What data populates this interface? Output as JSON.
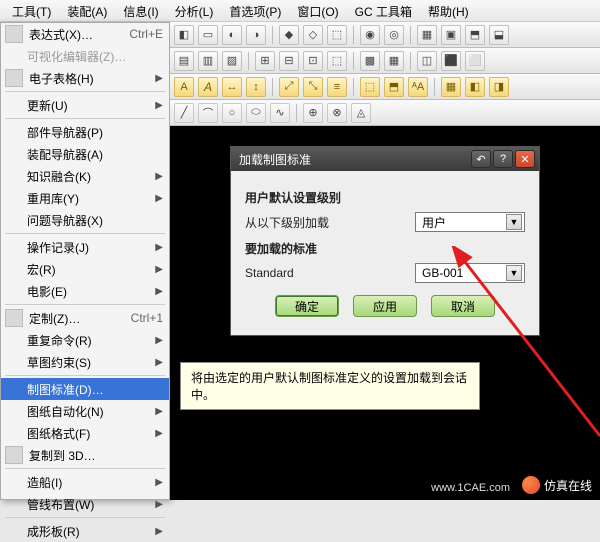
{
  "menubar": [
    "工具(T)",
    "装配(A)",
    "信息(I)",
    "分析(L)",
    "首选项(P)",
    "窗口(O)",
    "GC 工具箱",
    "帮助(H)"
  ],
  "dropdown": [
    {
      "label": "表达式(X)…",
      "shortcut": "Ctrl+E",
      "icon": true
    },
    {
      "label": "可视化编辑器(Z)…",
      "disabled": true
    },
    {
      "label": "电子表格(H)",
      "arrow": true,
      "icon": true
    },
    {
      "sep": true
    },
    {
      "label": "更新(U)",
      "arrow": true
    },
    {
      "sep": true
    },
    {
      "label": "部件导航器(P)"
    },
    {
      "label": "装配导航器(A)"
    },
    {
      "label": "知识融合(K)",
      "arrow": true
    },
    {
      "label": "重用库(Y)",
      "arrow": true
    },
    {
      "label": "问题导航器(X)"
    },
    {
      "sep": true
    },
    {
      "label": "操作记录(J)",
      "arrow": true
    },
    {
      "label": "宏(R)",
      "arrow": true
    },
    {
      "label": "电影(E)",
      "arrow": true
    },
    {
      "sep": true
    },
    {
      "label": "定制(Z)…",
      "shortcut": "Ctrl+1",
      "icon": true
    },
    {
      "label": "重复命令(R)",
      "arrow": true
    },
    {
      "label": "草图约束(S)",
      "arrow": true
    },
    {
      "sep": true
    },
    {
      "label": "制图标准(D)…",
      "selected": true
    },
    {
      "label": "图纸自动化(N)",
      "arrow": true
    },
    {
      "label": "图纸格式(F)",
      "arrow": true
    },
    {
      "label": "复制到 3D…",
      "icon": true
    },
    {
      "sep": true
    },
    {
      "label": "造船(I)",
      "arrow": true
    },
    {
      "label": "管线布置(W)",
      "arrow": true
    },
    {
      "sep": true
    },
    {
      "label": "成形板(R)",
      "arrow": true
    }
  ],
  "dialog": {
    "title": "加载制图标准",
    "section1": "用户默认设置级别",
    "row1_label": "从以下级别加载",
    "combo1": "用户",
    "section2": "要加载的标准",
    "row2_label": "Standard",
    "combo2": "GB-001",
    "ok": "确定",
    "apply": "应用",
    "cancel": "取消"
  },
  "tooltip": "将由选定的用户默认制图标准定义的设置加载到会话中。",
  "watermark": "1CAE",
  "footer": {
    "brand": "仿真在线",
    "url": "www.1CAE.com"
  }
}
